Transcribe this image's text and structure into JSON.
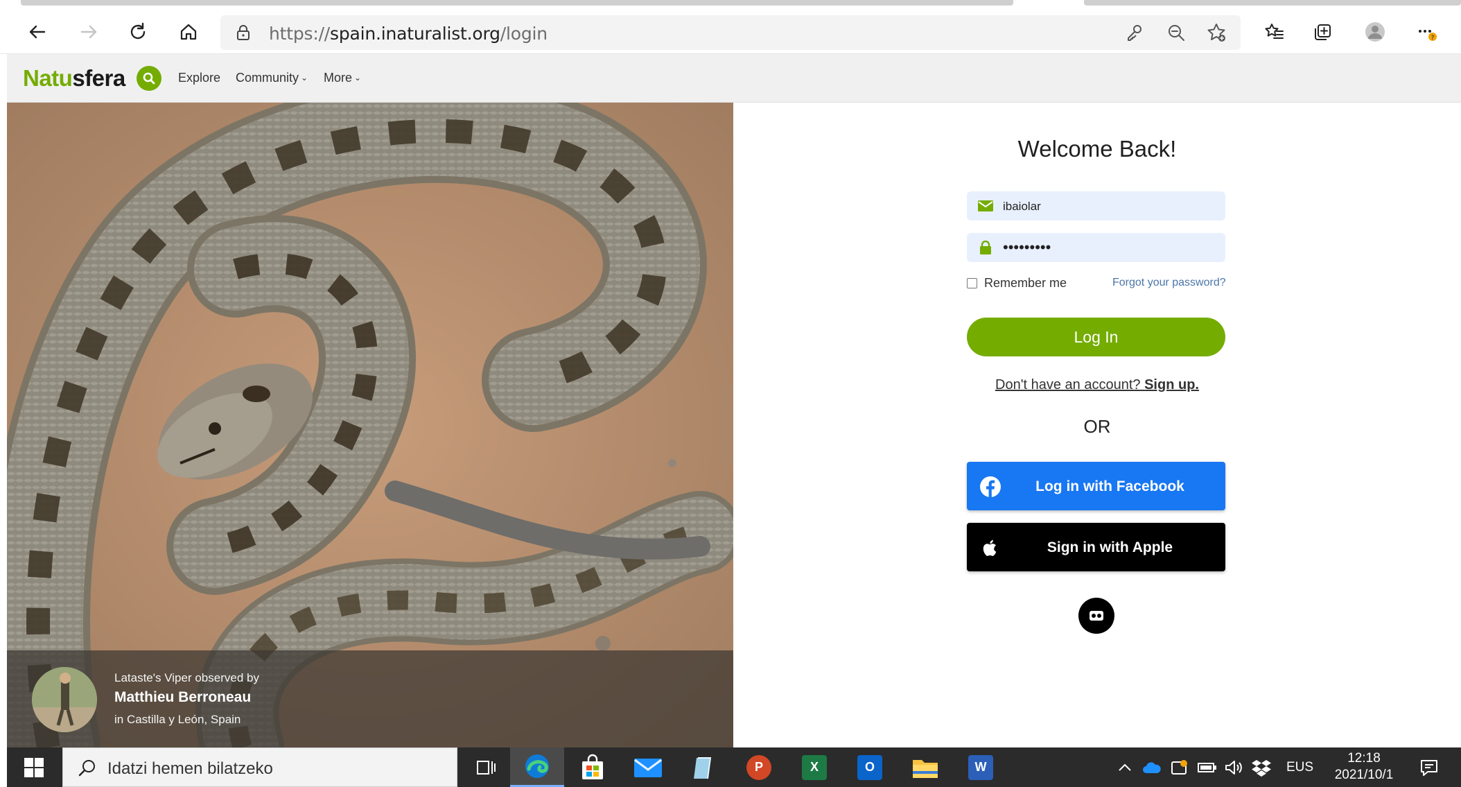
{
  "browser": {
    "url_scheme": "https://",
    "url_host": "spain.inaturalist.org",
    "url_path": "/login",
    "icons": [
      "back-icon",
      "forward-icon",
      "refresh-icon",
      "home-icon",
      "lock-icon",
      "key-icon",
      "zoom-out-icon",
      "favorite-add-icon",
      "favorites-icon",
      "collections-icon",
      "profile-icon",
      "more-icon"
    ]
  },
  "site": {
    "logo_prefix": "Natu",
    "logo_suffix": "sfera",
    "nav": {
      "explore": "Explore",
      "community": "Community",
      "more": "More"
    }
  },
  "photo": {
    "caption_line1": "Lataste's Viper observed by",
    "observer": "Matthieu Berroneau",
    "place": "in Castilla y León, Spain"
  },
  "login": {
    "title": "Welcome Back!",
    "username_value": "ibaiolar",
    "password_mask": "•••••••••",
    "remember_label": "Remember me",
    "forgot_label": "Forgot your password?",
    "login_button": "Log In",
    "signup_prefix": "Don't have an account?",
    "signup_link": "Sign up.",
    "or_label": "OR",
    "facebook_button": "Log in with Facebook",
    "apple_button": "Sign in with Apple"
  },
  "taskbar": {
    "search_placeholder": "Idatzi hemen bilatzeko",
    "language": "EUS",
    "time": "12:18",
    "date": "2021/10/1",
    "apps": [
      "task-view",
      "edge",
      "store",
      "mail",
      "notes",
      "powerpoint",
      "excel",
      "outlook",
      "file-explorer",
      "word"
    ]
  },
  "colors": {
    "brand_green": "#74ac00",
    "facebook_blue": "#1877f2",
    "apple_black": "#000000",
    "link_blue": "#4a75a8"
  }
}
